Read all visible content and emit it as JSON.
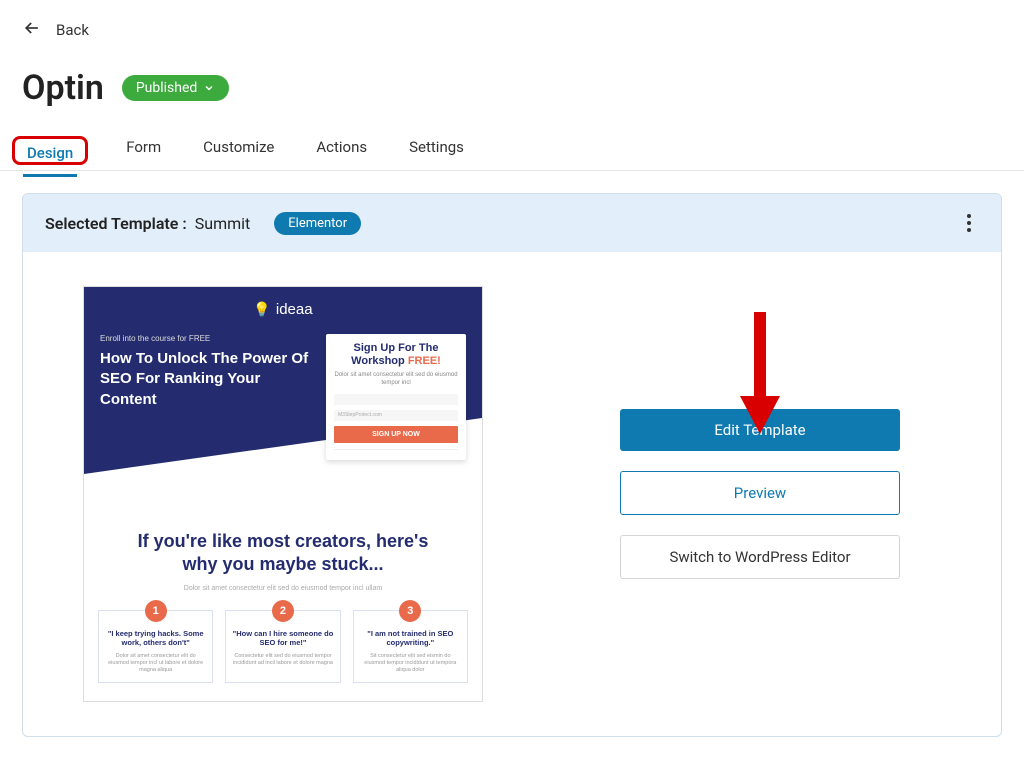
{
  "header": {
    "back_label": "Back",
    "title": "Optin",
    "status": "Published"
  },
  "tabs": {
    "design": "Design",
    "form": "Form",
    "customize": "Customize",
    "actions": "Actions",
    "settings": "Settings"
  },
  "panel": {
    "selected_label": "Selected Template :",
    "template_name": "Summit",
    "builder_badge": "Elementor"
  },
  "buttons": {
    "edit_template": "Edit Template",
    "preview": "Preview",
    "switch_editor": "Switch to WordPress Editor"
  },
  "template_preview": {
    "logo": "ideaa",
    "enroll": "Enroll into the course for FREE",
    "headline": "How To Unlock The Power Of SEO For Ranking Your Content",
    "signup_title_a": "Sign Up For The Workshop ",
    "signup_title_b": "FREE!",
    "signup_sub": "Dolor sit amet consectetur elit sed do eiusmod tempor incl",
    "input_placeholder": "M3StepProtect.com",
    "cta": "SIGN UP NOW",
    "h2_line1": "If you're like most creators, here's",
    "h2_line2": "why you maybe stuck...",
    "sub2": "Dolor sit amet consectetur elit sed do eiusmod tempor incl ullam",
    "cards": [
      {
        "num": "1",
        "title": "\"I keep trying hacks. Some work, others don't\"",
        "body": "Dolor sit amet consectetur elit do eiusmod tempor incl ut labore et dolore magna aliqua"
      },
      {
        "num": "2",
        "title": "\"How can I hire someone do SEO for me!\"",
        "body": "Consectetur elit sed do eiusmod tempor incididunt ad incil labore et dolore magna"
      },
      {
        "num": "3",
        "title": "\"I am not trained in SEO copywriting.\"",
        "body": "Sit consectetur elit sed eismin do eiusmod tempor incididunt ut tempora aliqua dolor"
      }
    ]
  }
}
